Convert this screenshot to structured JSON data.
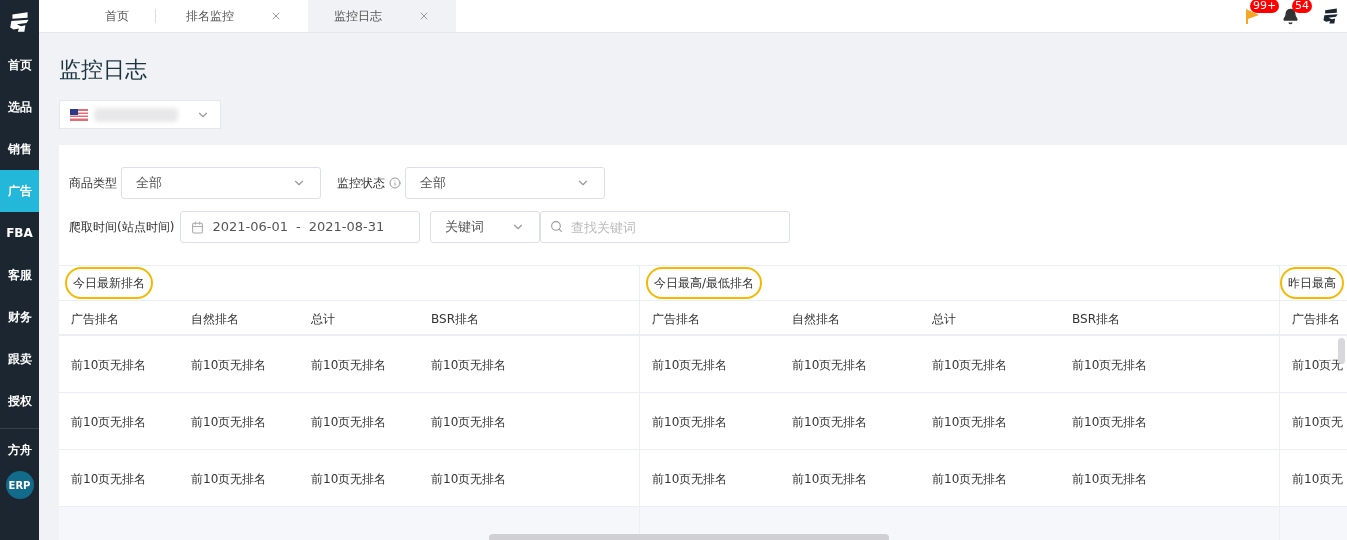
{
  "sidebar": {
    "items": [
      {
        "label": "首页",
        "selected": false
      },
      {
        "label": "选品",
        "selected": false
      },
      {
        "label": "销售",
        "selected": false
      },
      {
        "label": "广告",
        "selected": true
      },
      {
        "label": "FBA",
        "selected": false
      },
      {
        "label": "客服",
        "selected": false
      },
      {
        "label": "财务",
        "selected": false
      },
      {
        "label": "跟卖",
        "selected": false
      },
      {
        "label": "授权",
        "selected": false
      }
    ],
    "bottom_items": [
      {
        "label": "方舟"
      }
    ],
    "erp_badge": "ERP"
  },
  "tabs": [
    {
      "label": "首页",
      "closable": false,
      "selected": false
    },
    {
      "label": "排名监控",
      "closable": true,
      "selected": false
    },
    {
      "label": "监控日志",
      "closable": true,
      "selected": true
    }
  ],
  "topbar": {
    "flag_badge": "99+",
    "bell_badge": "54"
  },
  "page_title": "监控日志",
  "filters": {
    "product_type": {
      "label": "商品类型",
      "value": "全部"
    },
    "monitor_status": {
      "label": "监控状态",
      "value": "全部"
    },
    "crawl_time": {
      "label": "爬取时间(站点时间)",
      "start": "2021-06-01",
      "separator": "-",
      "end": "2021-08-31"
    },
    "keyword_type": {
      "value": "关键词"
    },
    "search": {
      "placeholder": "查找关键词"
    }
  },
  "table": {
    "groups": [
      {
        "title": "今日最新排名",
        "columns": [
          "广告排名",
          "自然排名",
          "总计",
          "BSR排名"
        ],
        "rows": [
          [
            "前10页无排名",
            "前10页无排名",
            "前10页无排名",
            "前10页无排名"
          ],
          [
            "前10页无排名",
            "前10页无排名",
            "前10页无排名",
            "前10页无排名"
          ],
          [
            "前10页无排名",
            "前10页无排名",
            "前10页无排名",
            "前10页无排名"
          ]
        ]
      },
      {
        "title": "今日最高/最低排名",
        "columns": [
          "广告排名",
          "自然排名",
          "总计",
          "BSR排名"
        ],
        "rows": [
          [
            "前10页无排名",
            "前10页无排名",
            "前10页无排名",
            "前10页无排名"
          ],
          [
            "前10页无排名",
            "前10页无排名",
            "前10页无排名",
            "前10页无排名"
          ],
          [
            "前10页无排名",
            "前10页无排名",
            "前10页无排名",
            "前10页无排名"
          ]
        ]
      },
      {
        "title": "昨日最高",
        "columns": [
          "广告排名"
        ],
        "rows": [
          [
            "前10页无"
          ],
          [
            "前10页无"
          ],
          [
            "前10页无"
          ]
        ]
      }
    ]
  }
}
